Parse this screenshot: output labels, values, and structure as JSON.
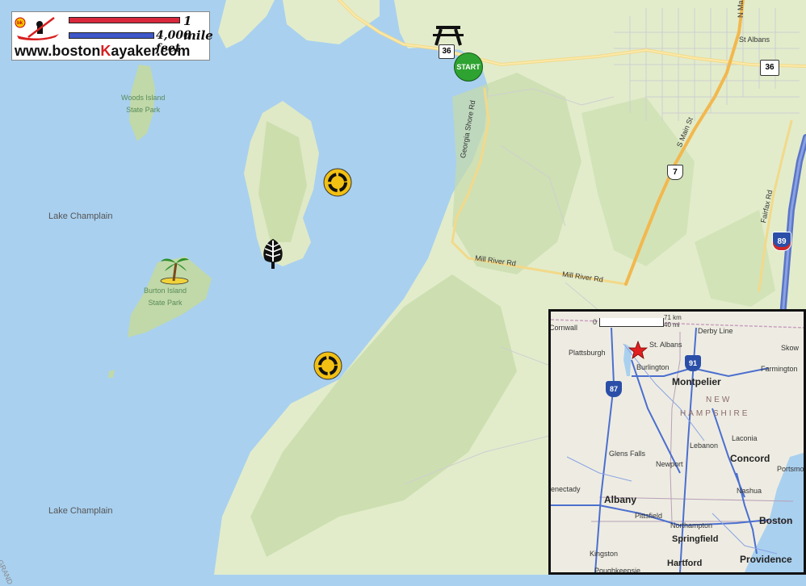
{
  "legend": {
    "scale_mile": "1 mile",
    "scale_feet": "4,000 feet",
    "url_prefix": "www.boston",
    "url_k": "K",
    "url_suffix": "ayaker.com",
    "logo": "boston-kayaker-logo-icon"
  },
  "water_labels": {
    "lake_upper": "Lake Champlain",
    "lake_lower": "Lake Champlain"
  },
  "parks": {
    "woods_line1": "Woods Island",
    "woods_line2": "State Park",
    "burton_line1": "Burton Island",
    "burton_line2": "State Park"
  },
  "roads": {
    "georgia_shore": "Georgia Shore Rd",
    "mill_river_1": "Mill River Rd",
    "mill_river_2": "Mill River Rd",
    "s_main": "S Main St",
    "fairfax": "Fairfax Rd",
    "n_main": "N Main",
    "route36_a": "36",
    "route36_b": "36",
    "route7": "7",
    "i89": "89",
    "grand": "GRAND"
  },
  "towns": {
    "st_albans": "St Albans"
  },
  "markers": {
    "start": "START",
    "picnic": "picnic-table-icon",
    "campsite": "campsite-icon",
    "forest": "tree-icon",
    "palm": "palm-island-icon"
  },
  "inset": {
    "scale_zero": "0",
    "scale_km": "71 km",
    "scale_mi": "40 mi",
    "labels": {
      "cornwall": "Cornwall",
      "derby_line": "Derby Line",
      "st_albans": "St. Albans",
      "skow": "Skow",
      "plattsburgh": "Plattsburgh",
      "burlington": "Burlington",
      "farmington": "Farmington",
      "montpelier": "Montpelier",
      "new": "NEW",
      "hampshire": "HAMPSHIRE",
      "laconia": "Laconia",
      "lebanon": "Lebanon",
      "glens_falls": "Glens Falls",
      "newport": "Newport",
      "concord": "Concord",
      "portsmo": "Portsmo",
      "nashua": "Nashua",
      "enectady": "enectady",
      "albany": "Albany",
      "pittsfield": "Pittsfield",
      "boston": "Boston",
      "northampton": "Northampton",
      "springfield": "Springfield",
      "kingston": "Kingston",
      "hartford": "Hartford",
      "providence": "Providence",
      "poughkeepsie": "Poughkeepsie"
    },
    "shields": {
      "i87": "87",
      "i91": "91"
    }
  }
}
